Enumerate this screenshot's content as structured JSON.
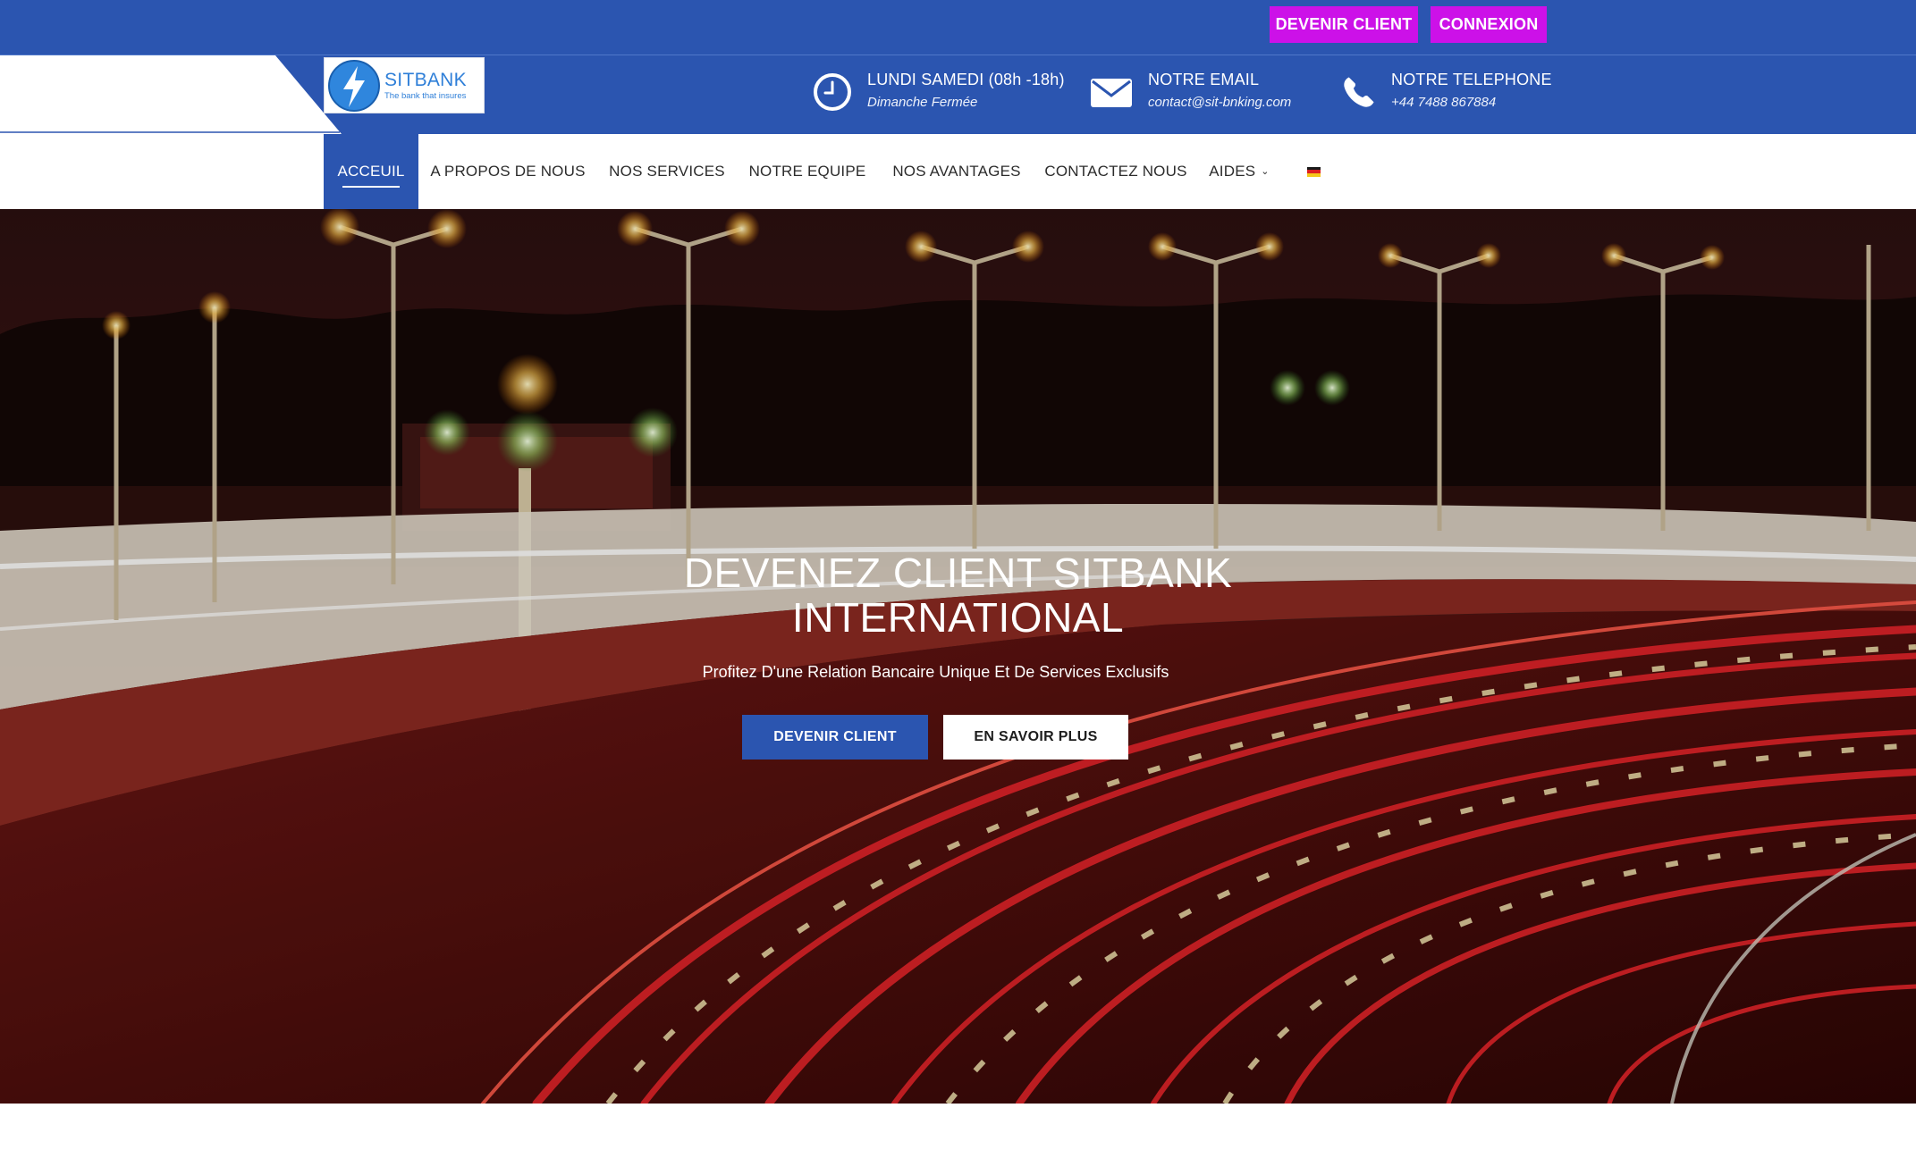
{
  "topbar": {
    "become_client_label": "DEVENIR CLIENT",
    "login_label": "CONNEXION"
  },
  "brand": {
    "name": "SITBANK",
    "tagline": "The bank that insures"
  },
  "info": {
    "hours_title": "LUNDI SAMEDI (08h -18h)",
    "hours_sub": "Dimanche Fermée",
    "email_title": "NOTRE EMAIL",
    "email_value": "contact@sit-bnking.com",
    "phone_title": "NOTRE TELEPHONE",
    "phone_value": "+44 7488 867884"
  },
  "nav": {
    "items": [
      {
        "label": "ACCEUIL",
        "active": true
      },
      {
        "label": "A PROPOS DE NOUS"
      },
      {
        "label": "NOS SERVICES"
      },
      {
        "label": "NOTRE EQUIPE"
      },
      {
        "label": "NOS AVANTAGES"
      },
      {
        "label": "CONTACTEZ NOUS"
      },
      {
        "label": "AIDES"
      }
    ],
    "chevron": "⌄",
    "language_flag": "germany-flag-icon"
  },
  "hero": {
    "title_line1": "DEVENEZ CLIENT SITBANK",
    "title_line2": "INTERNATIONAL",
    "subtitle": "Profitez D'une Relation Bancaire Unique Et De Services Exclusifs",
    "primary_button": "DEVENIR CLIENT",
    "secondary_button": "EN SAVOIR PLUS"
  },
  "colors": {
    "brand_blue": "#2b55b0",
    "accent_magenta": "#cc11e8",
    "hero_red": "#b01e22"
  }
}
